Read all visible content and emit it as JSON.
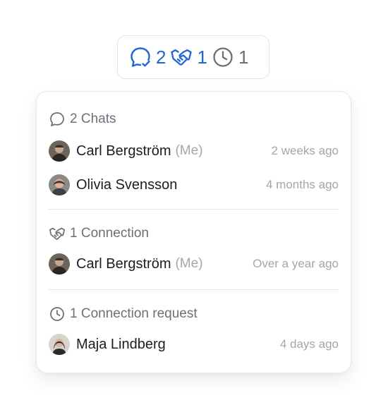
{
  "summary": {
    "chats_count": "2",
    "connections_count": "1",
    "requests_count": "1"
  },
  "chats": {
    "header": "2 Chats",
    "items": [
      {
        "name": "Carl Bergström",
        "me": "(Me)",
        "time": "2 weeks ago"
      },
      {
        "name": "Olivia Svensson",
        "time": "4 months ago"
      }
    ]
  },
  "connections": {
    "header": "1 Connection",
    "items": [
      {
        "name": "Carl Bergström",
        "me": "(Me)",
        "time": "Over a year ago"
      }
    ]
  },
  "requests": {
    "header": "1 Connection request",
    "items": [
      {
        "name": "Maja Lindberg",
        "time": "4 days ago"
      }
    ]
  },
  "icons": {
    "chat": "chat-bubble-icon",
    "connection": "handshake-icon",
    "request": "clock-icon"
  },
  "colors": {
    "accent": "#1f66d6",
    "muted": "#6b7078",
    "faint": "#a2a6ad",
    "text": "#1c1d20"
  }
}
